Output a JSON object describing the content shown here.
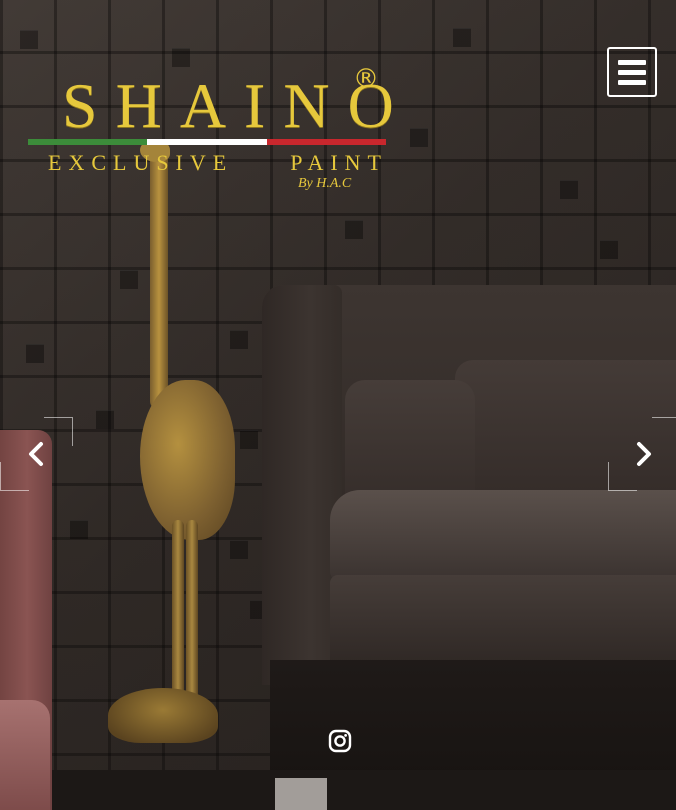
{
  "brand": {
    "name": "SHAINO",
    "registered": "®",
    "tagline_left": "EXCLUSIVE",
    "tagline_right": "PAINT",
    "signature": "By H.A.C",
    "flag_colors": [
      "#3c8c3a",
      "#ffffff",
      "#c8272d"
    ]
  },
  "header": {
    "menu_icon": "hamburger-icon"
  },
  "carousel": {
    "prev_icon": "chevron-left-icon",
    "next_icon": "chevron-right-icon",
    "prev_label": "‹",
    "next_label": "›"
  },
  "social": {
    "instagram_icon": "instagram-icon"
  },
  "colors": {
    "gold": "#e6c83c",
    "white": "#ffffff"
  }
}
